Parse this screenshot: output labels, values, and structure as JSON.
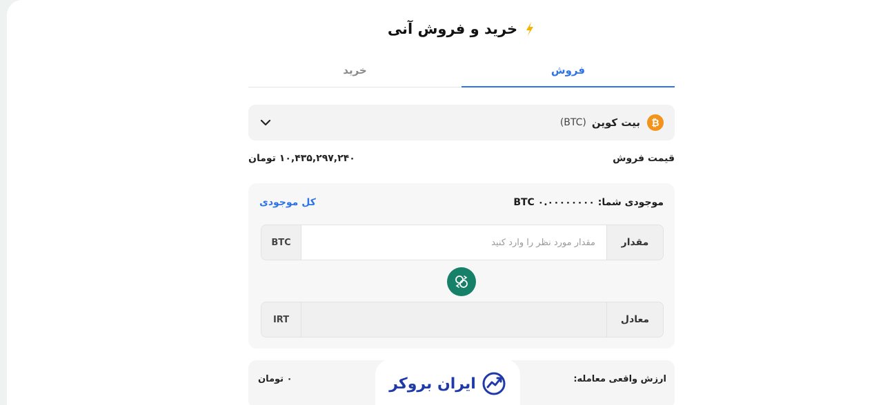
{
  "header": {
    "title": "خرید و فروش آنی"
  },
  "tabs": [
    {
      "label": "فروش",
      "active": true
    },
    {
      "label": "خرید",
      "active": false
    }
  ],
  "coin": {
    "name": "بیت کوین",
    "symbol": "(BTC)",
    "icon_glyph": "₿"
  },
  "price": {
    "label": "قیمت فروش",
    "value": "۱۰,۴۳۵,۲۹۷,۲۴۰ تومان"
  },
  "balance": {
    "label": "موجودی شما: BTC ۰.۰۰۰۰۰۰۰۰",
    "all_label": "کل موجودی"
  },
  "amount": {
    "label": "مقدار",
    "placeholder": "مقدار مورد نظر را وارد کنید",
    "value": "",
    "unit": "BTC"
  },
  "equivalent": {
    "label": "معادل",
    "value": "",
    "unit": "IRT"
  },
  "deal": {
    "label": "ارزش واقعی معامله:",
    "value": "۰ تومان"
  },
  "brand": {
    "name": "ایران بروکر"
  },
  "colors": {
    "accent": "#2f74e6",
    "swap": "#178069",
    "coin": "#f2931b",
    "brand": "#1f3aa8"
  }
}
